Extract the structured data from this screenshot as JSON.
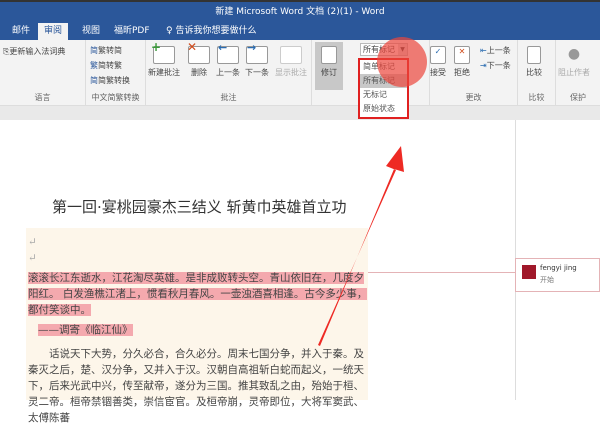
{
  "window": {
    "title": "新建 Microsoft Word 文档 (2)(1) - Word"
  },
  "tabs": [
    {
      "label": "邮件"
    },
    {
      "label": "审阅"
    },
    {
      "label": "视图"
    },
    {
      "label": "福昕PDF"
    }
  ],
  "tell_me": "告诉我你想要做什么",
  "ribbon": {
    "language": {
      "update_ime": "更新输入法词典",
      "label": "语言"
    },
    "chinese": {
      "t2s": "繁转简",
      "s2t": "简转繁",
      "convert": "简繁转换",
      "label": "中文简繁转换"
    },
    "comments": {
      "new": "新建批注",
      "delete": "删除",
      "prev": "上一条",
      "next": "下一条",
      "show": "显示批注",
      "label": "批注"
    },
    "tracking": {
      "track": "修订",
      "markup_value": "所有标记",
      "label": "修订"
    },
    "changes": {
      "accept": "接受",
      "reject": "拒绝",
      "prev": "上一条",
      "next": "下一条",
      "label": "更改"
    },
    "compare": {
      "compare": "比较",
      "label": "比较"
    },
    "protect": {
      "block": "阻止作者",
      "label": "保护"
    }
  },
  "markup_options": [
    "简单标记",
    "所有标记",
    "无标记",
    "原始状态"
  ],
  "document": {
    "title": "第一回·宴桃园豪杰三结义 斩黄巾英雄首立功",
    "poem": "滚滚长江东逝水，江花淘尽英雄。是非成败转头空。青山依旧在，几度夕阳红。 白发渔樵江渚上，惯看秋月春风。一壶浊酒喜相逢。古今多少事，都付笑谈中。",
    "poem_source": "——调寄《临江仙》",
    "body": "话说天下大势，分久必合，合久必分。周末七国分争，并入于秦。及秦灭之后，楚、汉分争，又并入于汉。汉朝自高祖斩白蛇而起义，一统天下，后来光武中兴，传至献帝，遂分为三国。推其致乱之由，殆始于桓、灵二帝。桓帝禁锢善类，崇信宦官。及桓帝崩，灵帝即位，大将军窦武、太傅陈蕃"
  },
  "comment": {
    "author": "fengyi jing",
    "text": "开始"
  },
  "colors": {
    "brand": "#2b579a",
    "highlight": "#f4a9ae",
    "annotation": "#e02020"
  }
}
